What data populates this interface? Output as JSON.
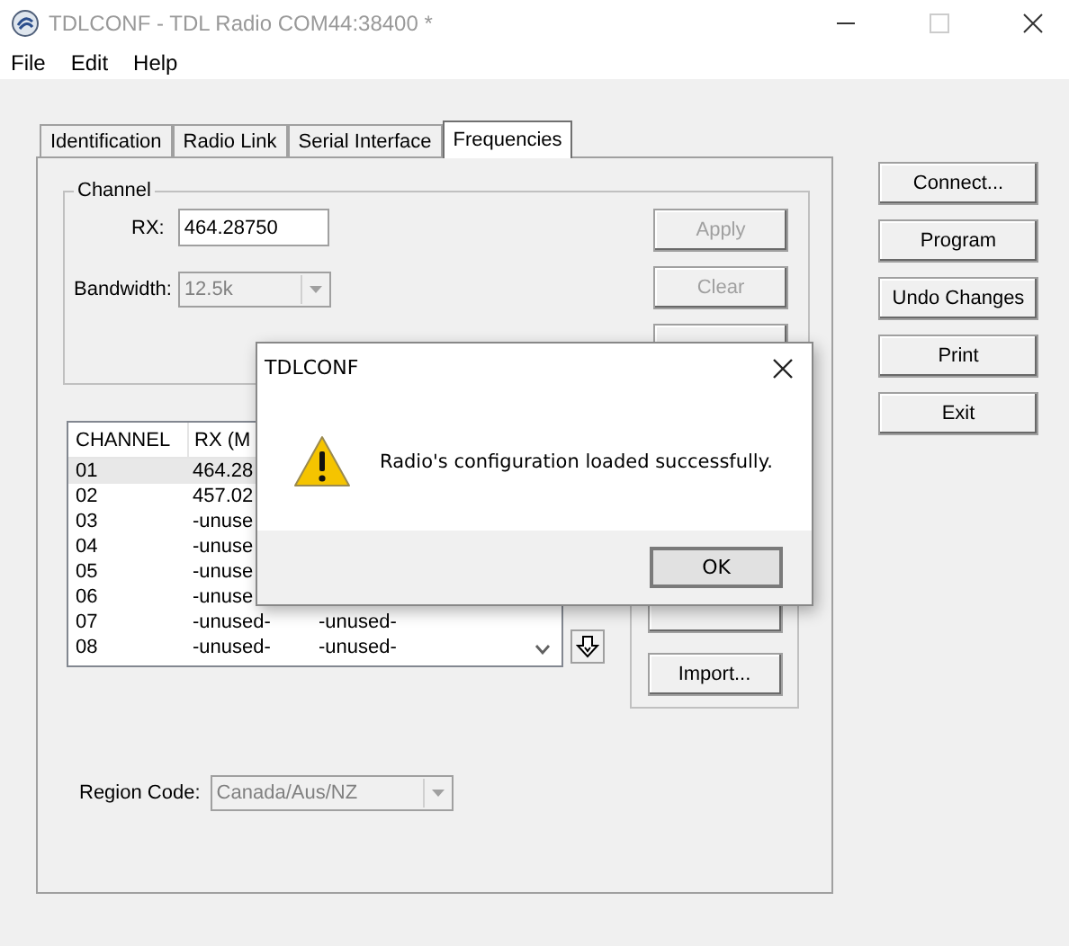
{
  "window": {
    "title": "TDLCONF - TDL Radio COM44:38400 *"
  },
  "menu": [
    "File",
    "Edit",
    "Help"
  ],
  "tabs": [
    {
      "label": "Identification",
      "selected": false
    },
    {
      "label": "Radio Link",
      "selected": false
    },
    {
      "label": "Serial Interface",
      "selected": false
    },
    {
      "label": "Frequencies",
      "selected": true
    }
  ],
  "channel": {
    "label": "Channel",
    "rx_label": "RX:",
    "rx_value": "464.28750",
    "bandwidth_label": "Bandwidth:",
    "bandwidth_value": "12.5k",
    "bandwidth_disabled": true,
    "buttons": [
      {
        "label": "Apply",
        "disabled": true
      },
      {
        "label": "Clear",
        "disabled": true
      }
    ]
  },
  "channel_list": {
    "columns": [
      "CHANNEL",
      "RX (M"
    ],
    "rows": [
      {
        "cells": [
          "01",
          "464.28"
        ],
        "selected": true
      },
      {
        "cells": [
          "02",
          "457.02"
        ],
        "selected": false
      },
      {
        "cells": [
          "03",
          "-unuse"
        ],
        "selected": false
      },
      {
        "cells": [
          "04",
          "-unuse"
        ],
        "selected": false
      },
      {
        "cells": [
          "05",
          "-unuse"
        ],
        "selected": false
      },
      {
        "cells": [
          "06",
          "-unuse"
        ],
        "selected": false
      },
      {
        "cells": [
          "07",
          "-unused-",
          "-unused-"
        ],
        "selected": false
      },
      {
        "cells": [
          "08",
          "-unused-",
          "-unused-"
        ],
        "selected": false
      }
    ]
  },
  "file_buttons": [
    "Import..."
  ],
  "region": {
    "label": "Region Code:",
    "value": "Canada/Aus/NZ",
    "disabled": true
  },
  "side_buttons": [
    "Connect...",
    "Program",
    "Undo Changes",
    "Print",
    "Exit"
  ],
  "dialog": {
    "title": "TDLCONF",
    "message": "Radio's configuration loaded successfully.",
    "button": "OK"
  }
}
